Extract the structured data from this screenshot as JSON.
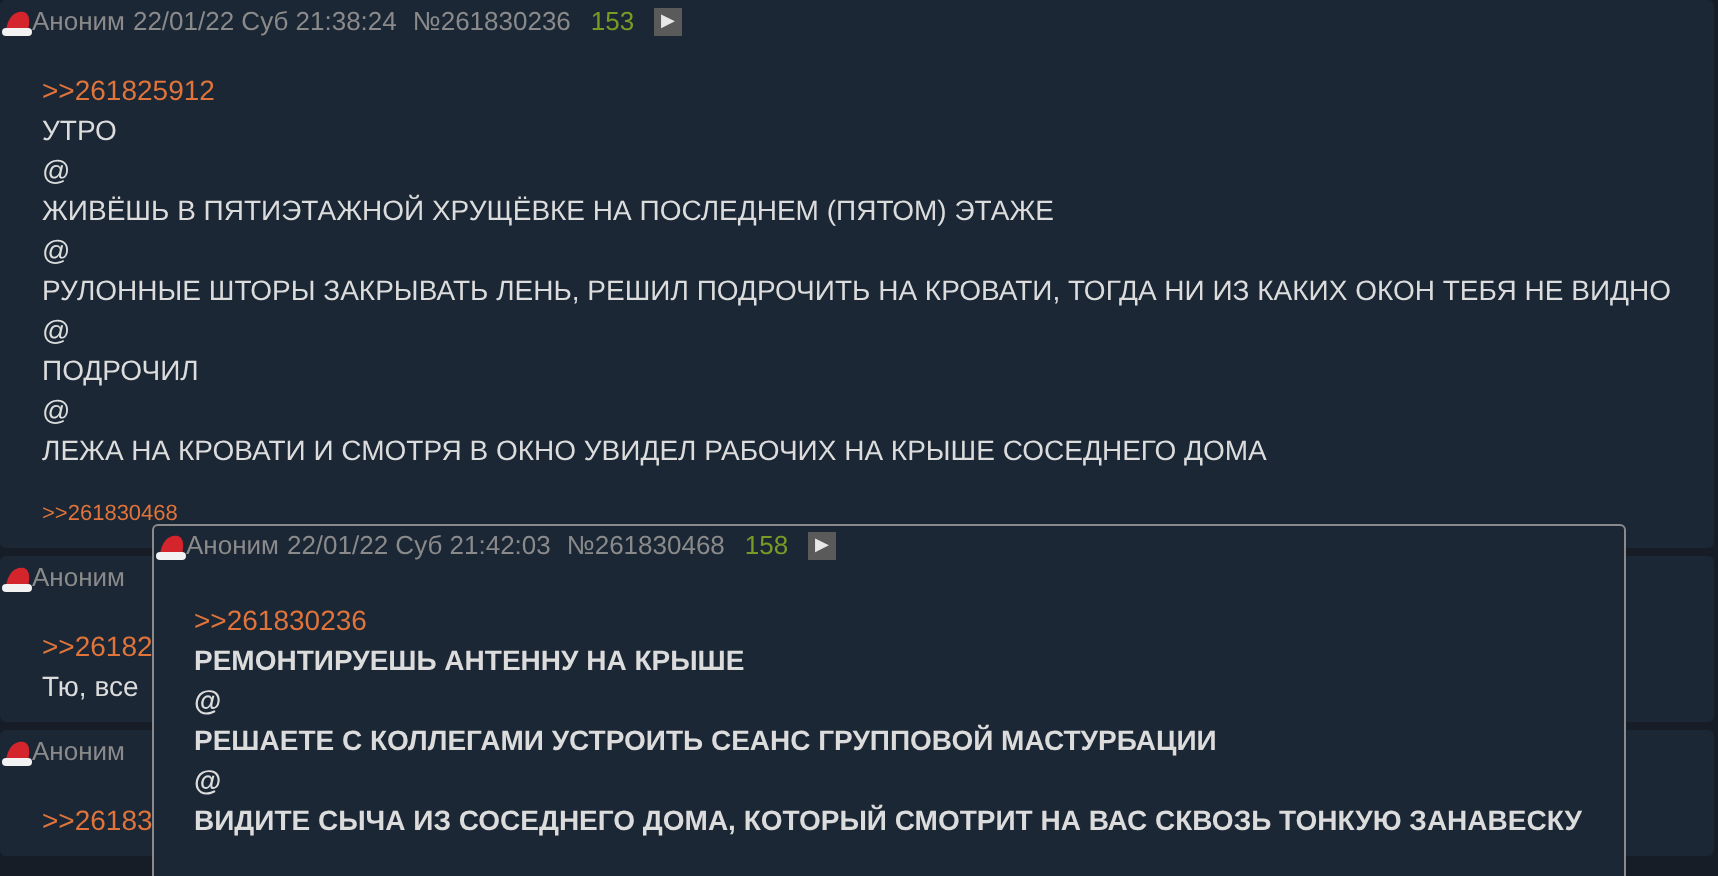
{
  "posts": [
    {
      "author": "Аноним",
      "date": "22/01/22 Суб 21:38:24",
      "number": "№261830236",
      "count": "153",
      "play": "▶",
      "lines": [
        {
          "kind": "link",
          "text": ">>261825912"
        },
        {
          "kind": "text",
          "text": "УТРО"
        },
        {
          "kind": "text",
          "text": "@"
        },
        {
          "kind": "text",
          "text": "ЖИВЁШЬ В ПЯТИЭТАЖНОЙ ХРУЩЁВКЕ НА ПОСЛЕДНЕМ (ПЯТОМ) ЭТАЖЕ"
        },
        {
          "kind": "text",
          "text": "@"
        },
        {
          "kind": "text",
          "text": "РУЛОННЫЕ ШТОРЫ ЗАКРЫВАТЬ ЛЕНЬ, РЕШИЛ ПОДРОЧИТЬ НА КРОВАТИ, ТОГДА НИ ИЗ КАКИХ ОКОН ТЕБЯ НЕ ВИДНО"
        },
        {
          "kind": "text",
          "text": "@"
        },
        {
          "kind": "text",
          "text": "ПОДРОЧИЛ"
        },
        {
          "kind": "text",
          "text": "@"
        },
        {
          "kind": "text",
          "text": "ЛЕЖА НА КРОВАТИ И СМОТРЯ В ОКНО УВИДЕЛ РАБОЧИХ НА КРЫШЕ СОСЕДНЕГО ДОМА"
        }
      ],
      "replies": [
        ">>261830468"
      ]
    },
    {
      "author": "Аноним",
      "lines": [
        {
          "kind": "link",
          "text": ">>26182"
        },
        {
          "kind": "text",
          "text": "Тю, все"
        }
      ]
    },
    {
      "author": "Аноним",
      "lines": [
        {
          "kind": "link",
          "text": ">>26183"
        }
      ]
    }
  ],
  "popup": {
    "author": "Аноним",
    "date": "22/01/22 Суб 21:42:03",
    "number": "№261830468",
    "count": "158",
    "play": "▶",
    "lines": [
      {
        "kind": "link",
        "text": ">>261830236"
      },
      {
        "kind": "text",
        "text": "РЕМОНТИРУЕШЬ АНТЕННУ НА КРЫШЕ"
      },
      {
        "kind": "text",
        "text": "@"
      },
      {
        "kind": "text",
        "text": "РЕШАЕТЕ С КОЛЛЕГАМИ УСТРОИТЬ СЕАНС ГРУППОВОЙ МАСТУРБАЦИИ"
      },
      {
        "kind": "text",
        "text": "@"
      },
      {
        "kind": "text",
        "text": "ВИДИТЕ СЫЧА ИЗ СОСЕДНЕГО ДОМА, КОТОРЫЙ СМОТРИТ НА ВАС СКВОЗЬ ТОНКУЮ ЗАНАВЕСКУ"
      }
    ]
  }
}
